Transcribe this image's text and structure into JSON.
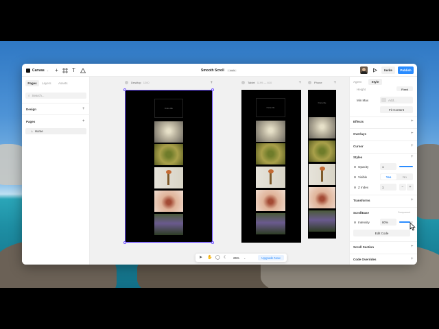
{
  "app": {
    "brand_label": "Canvas",
    "project_title": "Smooth Scroll",
    "project_badge": "main",
    "invite_label": "Invite",
    "publish_label": "Publish"
  },
  "left_panel": {
    "tabs": [
      "Pages",
      "Layers",
      "Assets"
    ],
    "search_placeholder": "Search...",
    "design_label": "Design",
    "pages_label": "Pages",
    "home_label": "Home"
  },
  "canvas": {
    "frames": [
      {
        "name": "Desktop",
        "size": "1200"
      },
      {
        "name": "Tablet",
        "size": "1199 — 810"
      },
      {
        "name": "Phone",
        "size": ""
      }
    ],
    "frame_title_text": "Frame title",
    "zoom": "26%",
    "upgrade_label": "Upgrade Now"
  },
  "right_panel": {
    "tabs": [
      "Agent",
      "Style"
    ],
    "height_label": "Height",
    "height_value": "Fixed",
    "minmax_label": "Min Max",
    "add_label": "Add...",
    "fit_content_label": "Fit Content",
    "sections": {
      "effects": "Effects",
      "overlays": "Overlays",
      "cursor": "Cursor",
      "styles": "Styles",
      "transforms": "Transforms",
      "scrollease": "ScrollEase",
      "component": "Component",
      "scroll_section": "Scroll Section",
      "code_overrides": "Code Overrides"
    },
    "styles": {
      "opacity_label": "Opacity",
      "opacity_value": "1",
      "visible_label": "Visible",
      "visible_yes": "Yes",
      "visible_no": "No",
      "zindex_label": "Z Index",
      "zindex_value": "1"
    },
    "intensity_label": "Intensity",
    "intensity_value": "80%",
    "intensity_level": 0.8,
    "edit_code_label": "Edit Code"
  },
  "colors": {
    "accent": "#2a8cff",
    "selection": "#6a4cff",
    "frame_bg": "#000000"
  }
}
